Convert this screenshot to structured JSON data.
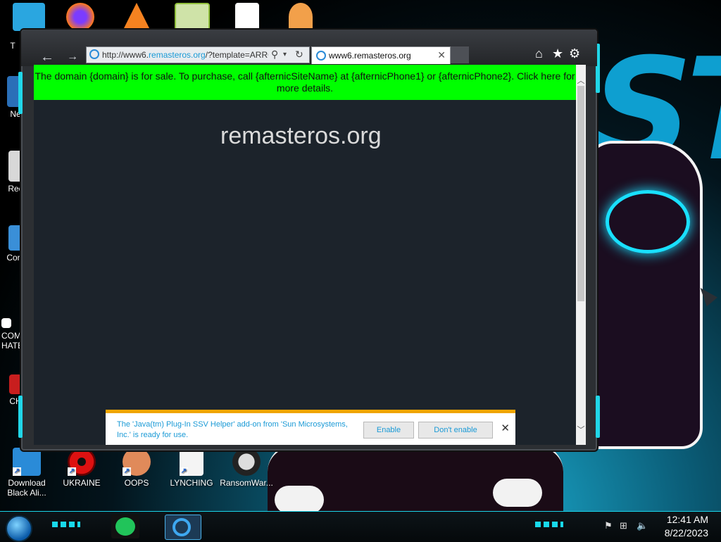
{
  "desktop": {
    "top_icons": [
      {
        "name": "monitor-icon",
        "color": "#2aa6e0"
      },
      {
        "name": "firefox-icon",
        "color": "#ff7a18"
      },
      {
        "name": "vlc-icon",
        "color": "#f58220"
      },
      {
        "name": "hxd-icon",
        "color": "#8fbf3a"
      },
      {
        "name": "blank-file-icon",
        "color": "#ffffff"
      },
      {
        "name": "user-icon",
        "color": "#f2a04a"
      }
    ],
    "left_labels": [
      "T",
      "Ne",
      "Rec",
      "Cont",
      "COMM\nHATE",
      "CH"
    ],
    "bottom_icons": [
      {
        "label": "Download Black Ali...",
        "icon": "monitor-icon"
      },
      {
        "label": "UKRAINE",
        "icon": "radiation-icon"
      },
      {
        "label": "OOPS",
        "icon": "face-icon"
      },
      {
        "label": "LYNCHING",
        "icon": "blank-file-icon"
      },
      {
        "label": "RansomWar...",
        "icon": "skull-icon"
      }
    ],
    "wallpaper_accent": "#19e0ff"
  },
  "browser": {
    "address": {
      "prefix": "http://www6.",
      "highlight": "remasteros.org",
      "suffix": "/?template=ARRO"
    },
    "tab_title": "www6.remasteros.org",
    "tab_close": "✕",
    "tools": [
      "⌂",
      "★",
      "⚙"
    ],
    "banner_text": "The domain {domain} is for sale. To purchase, call {afternicSiteName} at {afternicPhone1} or {afternicPhone2}. Click here for more details.",
    "banner_color": "#00ff00",
    "page_domain": "remasteros.org",
    "notification": {
      "message": "The 'Java(tm) Plug-In SSV Helper' add-on from 'Sun Microsystems, Inc.' is ready for use.",
      "enable_label": "Enable",
      "dont_enable_label": "Don't enable",
      "close": "✕",
      "accent": "#f0a500"
    }
  },
  "taskbar": {
    "time": "12:41 AM",
    "date": "8/22/2023",
    "accent": "#18d9ec"
  }
}
